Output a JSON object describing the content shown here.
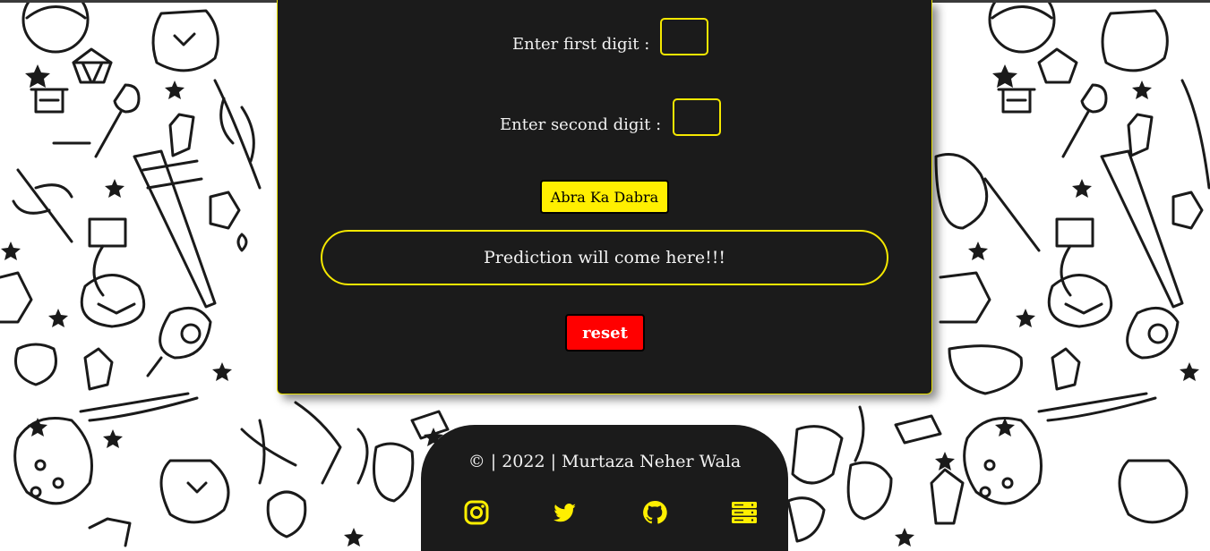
{
  "form": {
    "first_label": "Enter first digit :",
    "second_label": "Enter second digit :",
    "first_value": "",
    "second_value": "",
    "submit_label": "Abra Ka Dabra",
    "prediction_text": "Prediction will come here!!!",
    "reset_label": "reset"
  },
  "footer": {
    "copyright": "© | 2022 | Murtaza Neher Wala",
    "links": [
      {
        "icon": "instagram-icon"
      },
      {
        "icon": "twitter-icon"
      },
      {
        "icon": "github-icon"
      },
      {
        "icon": "server-icon"
      }
    ]
  },
  "colors": {
    "accent": "#ffef00",
    "panel": "#1b1b1b",
    "reset": "#ff0000"
  }
}
